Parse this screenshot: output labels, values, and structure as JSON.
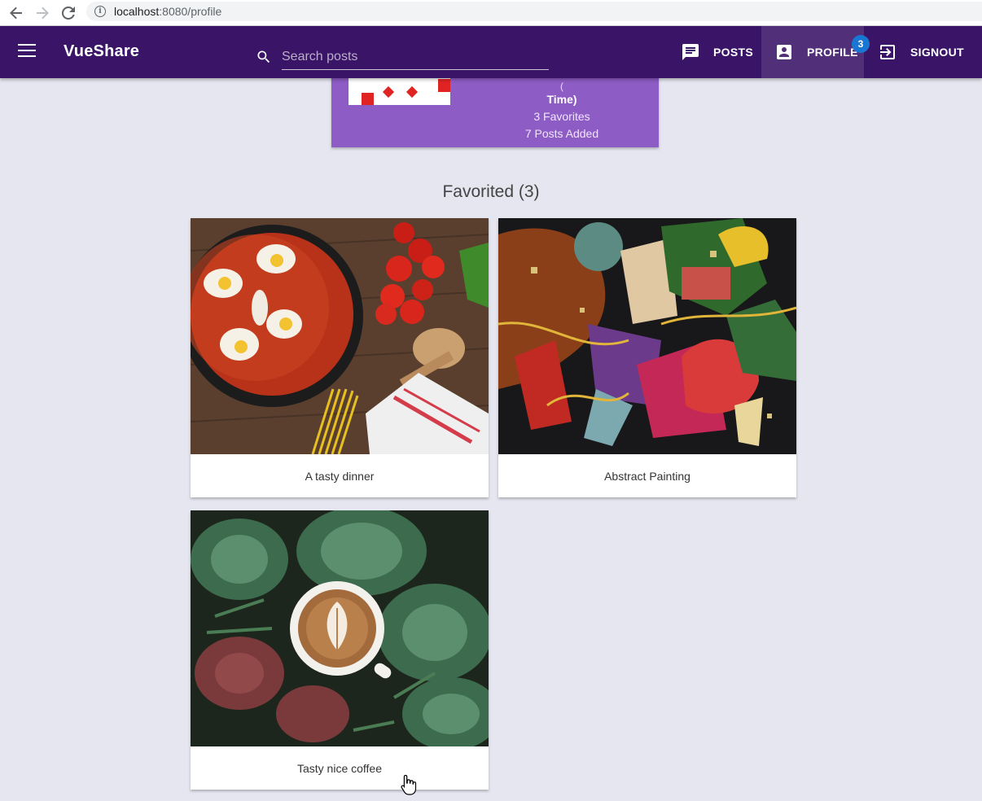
{
  "browser": {
    "url_host": "localhost",
    "url_path": ":8080/profile"
  },
  "header": {
    "title": "VueShare",
    "search_placeholder": "Search posts",
    "nav": {
      "posts_label": "POSTS",
      "profile_label": "PROFILE",
      "signout_label": "SIGNOUT",
      "profile_badge": "3"
    },
    "icons": [
      "menu-icon",
      "search-icon",
      "chat-icon",
      "account-box-icon",
      "exit-icon"
    ],
    "colors": {
      "app_bar": "#3a1467",
      "badge": "#1976d2"
    }
  },
  "profile": {
    "paren": "(",
    "time_label": "Time)",
    "favorites": "3 Favorites",
    "posts_added": "7 Posts Added",
    "card_color": "#8d5cc4"
  },
  "favorited": {
    "heading": "Favorited",
    "count": "(3)",
    "cards": [
      {
        "caption": "A tasty dinner"
      },
      {
        "caption": "Abstract Painting"
      },
      {
        "caption": "Tasty nice coffee"
      }
    ]
  }
}
